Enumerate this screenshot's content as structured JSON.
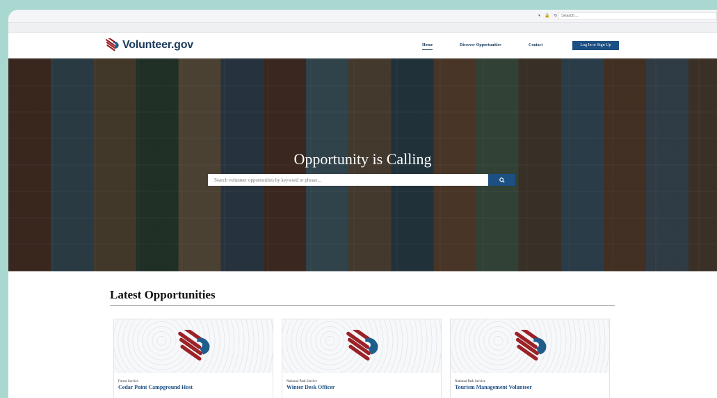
{
  "browser": {
    "search_placeholder": "Search..."
  },
  "header": {
    "logo_text": "Volunteer.gov",
    "nav": {
      "home": "Home",
      "discover": "Discover Opportunities",
      "contact": "Contact"
    },
    "login_label": "Log In or Sign Up"
  },
  "hero": {
    "title": "Opportunity is Calling",
    "search_placeholder": "Search volunteer opportunities by keyword or phrase..."
  },
  "latest": {
    "title": "Latest Opportunities",
    "cards": [
      {
        "agency": "Forest Service",
        "title": "Cedar Point Campground Host"
      },
      {
        "agency": "National Park Service",
        "title": "Winter Desk Officer"
      },
      {
        "agency": "National Park Service",
        "title": "Tourism Management Volunteer"
      }
    ]
  },
  "colors": {
    "brand_navy": "#1a3a5c",
    "button_blue": "#1c4f82",
    "logo_red": "#9b2226",
    "logo_blue": "#1f5d8c",
    "page_border": "#a9d8d1"
  },
  "icons": [
    "lock-icon",
    "refresh-icon",
    "search-icon",
    "volunteer-hands-logo-icon"
  ]
}
